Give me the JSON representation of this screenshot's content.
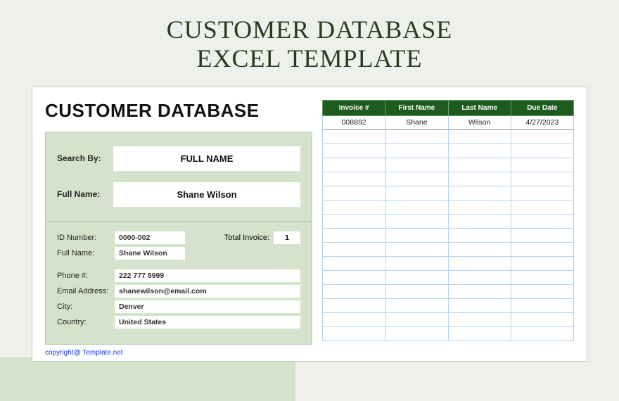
{
  "page": {
    "title_line1": "CUSTOMER DATABASE",
    "title_line2": "EXCEL TEMPLATE"
  },
  "sheet": {
    "heading": "CUSTOMER DATABASE",
    "search": {
      "search_by_label": "Search By:",
      "search_by_value": "FULL NAME",
      "full_name_label": "Full Name:",
      "full_name_value": "Shane Wilson"
    },
    "details": {
      "id_label": "ID Number:",
      "id_value": "0000-002",
      "total_invoice_label": "Total Invoice:",
      "total_invoice_value": "1",
      "name_label": "Full Name:",
      "name_value": "Shane Wilson",
      "phone_label": "Phone #:",
      "phone_value": "222 777 8999",
      "email_label": "Email Address:",
      "email_value": "shanewilson@email.com",
      "city_label": "City:",
      "city_value": "Denver",
      "country_label": "Country:",
      "country_value": "United States"
    },
    "table": {
      "headers": [
        "Invoice #",
        "First Name",
        "Last Name",
        "Due Date"
      ],
      "rows": [
        [
          "008892",
          "Shane",
          "Wilson",
          "4/27/2023"
        ]
      ],
      "empty_rows": 15
    },
    "copyright": "copyright@ Template.net"
  }
}
